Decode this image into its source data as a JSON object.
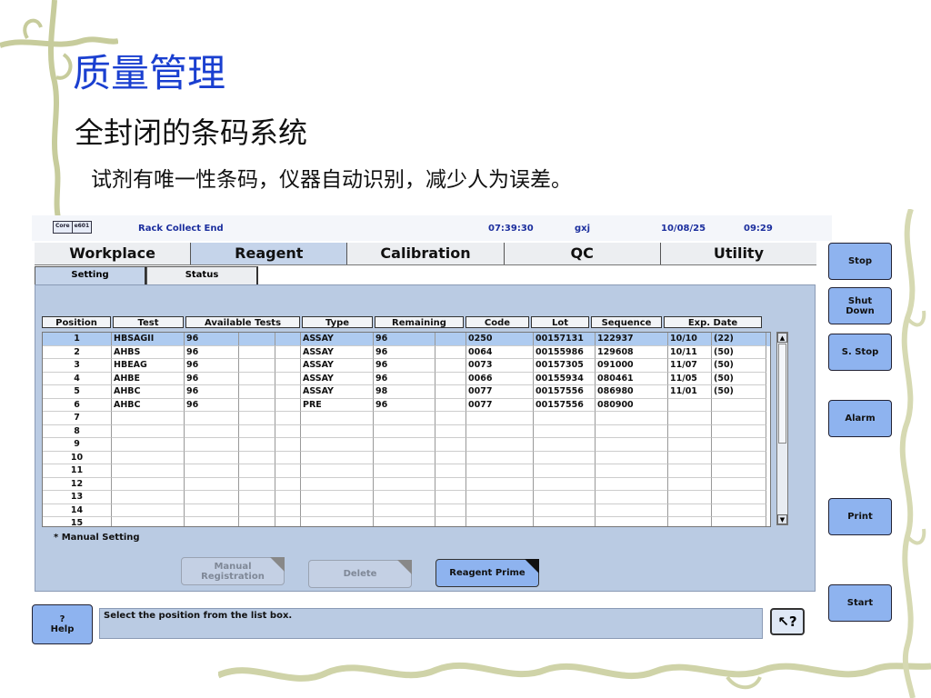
{
  "slide": {
    "title": "质量管理",
    "subtitle": "全封闭的条码系统",
    "description": "试剂有唯一性条码，仪器自动识别，减少人为误差。"
  },
  "app": {
    "logo_parts": [
      "Core",
      "e601"
    ],
    "status_message": "Rack Collect End",
    "time_a": "07:39:30",
    "user": "gxj",
    "date": "10/08/25",
    "time_b": "09:29",
    "main_tabs": [
      "Workplace",
      "Reagent",
      "Calibration",
      "QC",
      "Utility"
    ],
    "active_main_tab": "Reagent",
    "sub_tabs": [
      "Setting",
      "Status"
    ],
    "grid": {
      "headers": [
        "Position",
        "Test",
        "Available Tests",
        "Type",
        "Remaining",
        "Code",
        "Lot",
        "Sequence",
        "Exp. Date"
      ],
      "rows": [
        [
          "1",
          "HBSAGII",
          "96",
          "",
          "",
          "ASSAY",
          "96",
          "",
          "0250",
          "00157131",
          "122937",
          "10/10",
          "(22)"
        ],
        [
          "2",
          "AHBS",
          "96",
          "",
          "",
          "ASSAY",
          "96",
          "",
          "0064",
          "00155986",
          "129608",
          "10/11",
          "(50)"
        ],
        [
          "3",
          "HBEAG",
          "96",
          "",
          "",
          "ASSAY",
          "96",
          "",
          "0073",
          "00157305",
          "091000",
          "11/07",
          "(50)"
        ],
        [
          "4",
          "AHBE",
          "96",
          "",
          "",
          "ASSAY",
          "96",
          "",
          "0066",
          "00155934",
          "080461",
          "11/05",
          "(50)"
        ],
        [
          "5",
          "AHBC",
          "96",
          "",
          "",
          "ASSAY",
          "98",
          "",
          "0077",
          "00157556",
          "086980",
          "11/01",
          "(50)"
        ],
        [
          "6",
          "AHBC",
          "96",
          "",
          "",
          "PRE",
          "96",
          "",
          "0077",
          "00157556",
          "080900",
          "",
          ""
        ],
        [
          "7",
          "",
          "",
          "",
          "",
          "",
          "",
          "",
          "",
          "",
          "",
          "",
          ""
        ],
        [
          "8",
          "",
          "",
          "",
          "",
          "",
          "",
          "",
          "",
          "",
          "",
          "",
          ""
        ],
        [
          "9",
          "",
          "",
          "",
          "",
          "",
          "",
          "",
          "",
          "",
          "",
          "",
          ""
        ],
        [
          "10",
          "",
          "",
          "",
          "",
          "",
          "",
          "",
          "",
          "",
          "",
          "",
          ""
        ],
        [
          "11",
          "",
          "",
          "",
          "",
          "",
          "",
          "",
          "",
          "",
          "",
          "",
          ""
        ],
        [
          "12",
          "",
          "",
          "",
          "",
          "",
          "",
          "",
          "",
          "",
          "",
          "",
          ""
        ],
        [
          "13",
          "",
          "",
          "",
          "",
          "",
          "",
          "",
          "",
          "",
          "",
          "",
          ""
        ],
        [
          "14",
          "",
          "",
          "",
          "",
          "",
          "",
          "",
          "",
          "",
          "",
          "",
          ""
        ],
        [
          "15",
          "",
          "",
          "",
          "",
          "",
          "",
          "",
          "",
          "",
          "",
          "",
          ""
        ]
      ]
    },
    "manual_setting_note": "* Manual Setting",
    "buttons": {
      "manual_registration": "Manual\nRegistration",
      "delete": "Delete",
      "reagent_prime": "Reagent Prime"
    },
    "side_buttons": {
      "stop": "Stop",
      "shut_down": "Shut\nDown",
      "s_stop": "S. Stop",
      "alarm": "Alarm",
      "print": "Print",
      "start": "Start"
    },
    "help_label": "?\nHelp",
    "status_bar": "Select the position from the list box.",
    "pointer_help_glyph": "↖?"
  },
  "colors": {
    "title_blue": "#1a3fd0",
    "panel": "#bacbe3",
    "button_blue": "#8eb3ef",
    "selected_row": "#aecbf0"
  }
}
